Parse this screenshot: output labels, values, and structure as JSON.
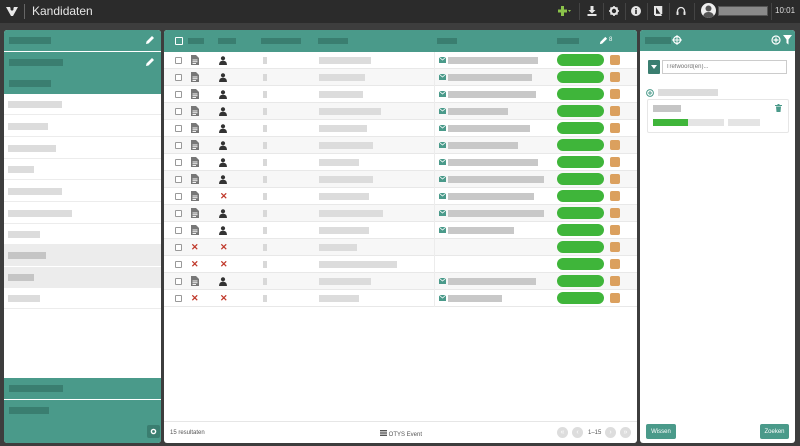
{
  "app": {
    "title": "Kandidaten",
    "clock": "10:01"
  },
  "colors": {
    "accent": "#4a9a8a",
    "accent_dark": "#3a7e70",
    "status_green": "#3fb53a",
    "tag_orange": "#dba05e",
    "delete_red": "#c0392b",
    "topbar": "#2b2b2b"
  },
  "toolbar": {
    "icons": [
      "plus-icon",
      "download-icon",
      "gear-icon",
      "info-icon",
      "book-icon",
      "headset-icon"
    ]
  },
  "table": {
    "header_count": "8",
    "rows": [
      {
        "cv": true,
        "person": true,
        "name_w": 52,
        "mail": true,
        "mail_w": 90
      },
      {
        "cv": true,
        "person": true,
        "name_w": 46,
        "mail": true,
        "mail_w": 84
      },
      {
        "cv": true,
        "person": true,
        "name_w": 44,
        "mail": true,
        "mail_w": 88
      },
      {
        "cv": true,
        "person": true,
        "name_w": 62,
        "mail": true,
        "mail_w": 60
      },
      {
        "cv": true,
        "person": true,
        "name_w": 48,
        "mail": true,
        "mail_w": 82
      },
      {
        "cv": true,
        "person": true,
        "name_w": 54,
        "mail": true,
        "mail_w": 70
      },
      {
        "cv": true,
        "person": true,
        "name_w": 40,
        "mail": true,
        "mail_w": 90
      },
      {
        "cv": true,
        "person": true,
        "name_w": 54,
        "mail": true,
        "mail_w": 96
      },
      {
        "cv": true,
        "person": false,
        "name_w": 50,
        "mail": true,
        "mail_w": 86
      },
      {
        "cv": true,
        "person": true,
        "name_w": 64,
        "mail": true,
        "mail_w": 96
      },
      {
        "cv": true,
        "person": true,
        "name_w": 50,
        "mail": true,
        "mail_w": 66
      },
      {
        "cv": false,
        "person": false,
        "name_w": 38,
        "mail": false,
        "mail_w": 0
      },
      {
        "cv": false,
        "person": false,
        "name_w": 78,
        "mail": false,
        "mail_w": 0
      },
      {
        "cv": true,
        "person": true,
        "name_w": 52,
        "mail": true,
        "mail_w": 88
      },
      {
        "cv": false,
        "person": false,
        "name_w": 40,
        "mail": true,
        "mail_w": 54
      }
    ]
  },
  "footer": {
    "results": "15 resultaten",
    "event": "OTYS Event",
    "pages": "1–15"
  },
  "search": {
    "placeholder": "Trefwoord(en)..."
  },
  "buttons": {
    "clear": "Wissen",
    "search": "Zoeken"
  }
}
